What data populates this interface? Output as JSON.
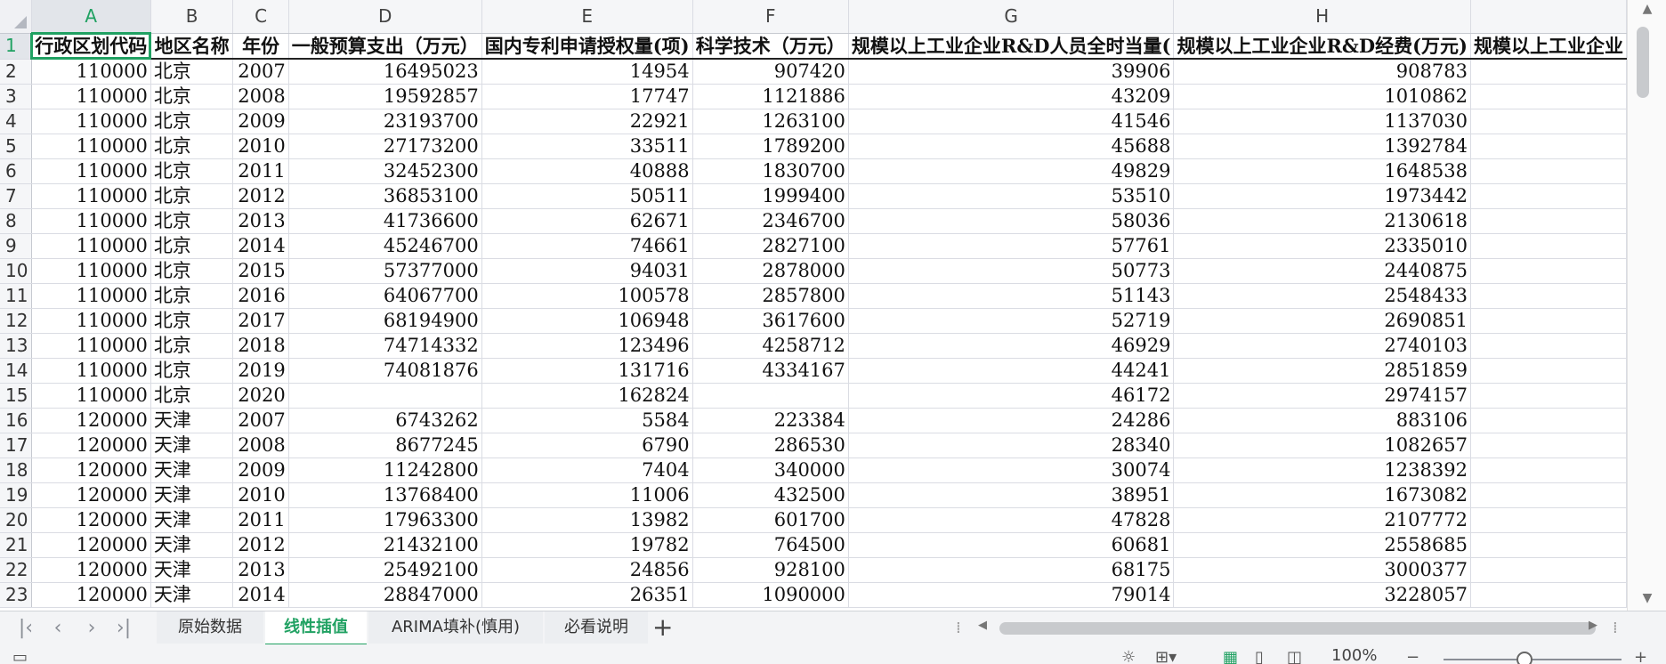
{
  "columns": [
    "A",
    "B",
    "C",
    "D",
    "E",
    "F",
    "G",
    "H",
    ""
  ],
  "header_row": [
    "行政区划代码",
    "地区名称",
    "年份",
    "一般预算支出（万元）",
    "国内专利申请授权量(项)",
    "科学技术（万元）",
    "规模以上工业企业R&D人员全时当量(",
    "规模以上工业企业R&D经费(万元)",
    "规模以上工业企业"
  ],
  "rows": [
    {
      "n": "2",
      "cells": [
        "110000",
        "北京",
        "2007",
        "16495023",
        "14954",
        "907420",
        "39906",
        "908783",
        ""
      ]
    },
    {
      "n": "3",
      "cells": [
        "110000",
        "北京",
        "2008",
        "19592857",
        "17747",
        "1121886",
        "43209",
        "1010862",
        ""
      ]
    },
    {
      "n": "4",
      "cells": [
        "110000",
        "北京",
        "2009",
        "23193700",
        "22921",
        "1263100",
        "41546",
        "1137030",
        ""
      ]
    },
    {
      "n": "5",
      "cells": [
        "110000",
        "北京",
        "2010",
        "27173200",
        "33511",
        "1789200",
        "45688",
        "1392784",
        ""
      ]
    },
    {
      "n": "6",
      "cells": [
        "110000",
        "北京",
        "2011",
        "32452300",
        "40888",
        "1830700",
        "49829",
        "1648538",
        ""
      ]
    },
    {
      "n": "7",
      "cells": [
        "110000",
        "北京",
        "2012",
        "36853100",
        "50511",
        "1999400",
        "53510",
        "1973442",
        ""
      ]
    },
    {
      "n": "8",
      "cells": [
        "110000",
        "北京",
        "2013",
        "41736600",
        "62671",
        "2346700",
        "58036",
        "2130618",
        ""
      ]
    },
    {
      "n": "9",
      "cells": [
        "110000",
        "北京",
        "2014",
        "45246700",
        "74661",
        "2827100",
        "57761",
        "2335010",
        ""
      ]
    },
    {
      "n": "10",
      "cells": [
        "110000",
        "北京",
        "2015",
        "57377000",
        "94031",
        "2878000",
        "50773",
        "2440875",
        ""
      ]
    },
    {
      "n": "11",
      "cells": [
        "110000",
        "北京",
        "2016",
        "64067700",
        "100578",
        "2857800",
        "51143",
        "2548433",
        ""
      ]
    },
    {
      "n": "12",
      "cells": [
        "110000",
        "北京",
        "2017",
        "68194900",
        "106948",
        "3617600",
        "52719",
        "2690851",
        ""
      ]
    },
    {
      "n": "13",
      "cells": [
        "110000",
        "北京",
        "2018",
        "74714332",
        "123496",
        "4258712",
        "46929",
        "2740103",
        ""
      ]
    },
    {
      "n": "14",
      "cells": [
        "110000",
        "北京",
        "2019",
        "74081876",
        "131716",
        "4334167",
        "44241",
        "2851859",
        ""
      ]
    },
    {
      "n": "15",
      "cells": [
        "110000",
        "北京",
        "2020",
        "",
        "162824",
        "",
        "46172",
        "2974157",
        ""
      ]
    },
    {
      "n": "16",
      "cells": [
        "120000",
        "天津",
        "2007",
        "6743262",
        "5584",
        "223384",
        "24286",
        "883106",
        ""
      ]
    },
    {
      "n": "17",
      "cells": [
        "120000",
        "天津",
        "2008",
        "8677245",
        "6790",
        "286530",
        "28340",
        "1082657",
        ""
      ]
    },
    {
      "n": "18",
      "cells": [
        "120000",
        "天津",
        "2009",
        "11242800",
        "7404",
        "340000",
        "30074",
        "1238392",
        ""
      ]
    },
    {
      "n": "19",
      "cells": [
        "120000",
        "天津",
        "2010",
        "13768400",
        "11006",
        "432500",
        "38951",
        "1673082",
        ""
      ]
    },
    {
      "n": "20",
      "cells": [
        "120000",
        "天津",
        "2011",
        "17963300",
        "13982",
        "601700",
        "47828",
        "2107772",
        ""
      ]
    },
    {
      "n": "21",
      "cells": [
        "120000",
        "天津",
        "2012",
        "21432100",
        "19782",
        "764500",
        "60681",
        "2558685",
        ""
      ]
    },
    {
      "n": "22",
      "cells": [
        "120000",
        "天津",
        "2013",
        "25492100",
        "24856",
        "928100",
        "68175",
        "3000377",
        ""
      ]
    },
    {
      "n": "23",
      "cells": [
        "120000",
        "天津",
        "2014",
        "28847000",
        "26351",
        "1090000",
        "79014",
        "3228057",
        ""
      ]
    }
  ],
  "sheet_tabs": [
    "原始数据",
    "线性插值",
    "ARIMA填补(慎用)",
    "必看说明"
  ],
  "active_tab": "线性插值",
  "zoom": "100%",
  "accent_color": "#20a162",
  "icons": {
    "first": "first-sheet-icon",
    "prev": "prev-sheet-icon",
    "next": "next-sheet-icon",
    "last": "last-sheet-icon",
    "add": "add-sheet-icon",
    "zoom_out": "zoom-out-icon",
    "zoom_in": "zoom-in-icon",
    "eye": "eye-protect-icon",
    "view_normal": "normal-view-icon",
    "view_page": "page-layout-icon",
    "view_break": "page-break-icon"
  }
}
